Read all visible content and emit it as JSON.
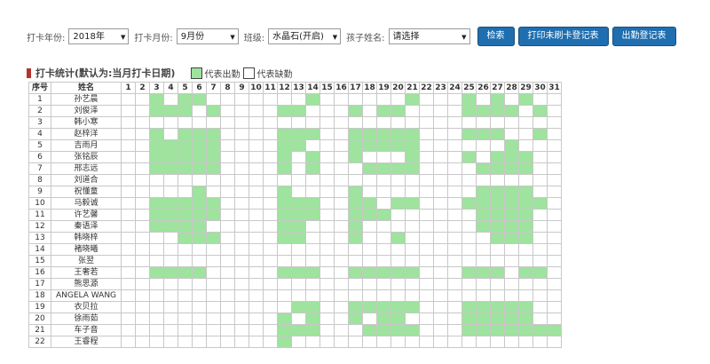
{
  "filters": {
    "year_label": "打卡年份:",
    "year_value": "2018年",
    "month_label": "打卡月份:",
    "month_value": "9月份",
    "class_label": "班级:",
    "class_value": "水晶石(开启)",
    "child_label": "孩子姓名:",
    "child_value": "请选择"
  },
  "buttons": {
    "search": "检索",
    "print_missed": "打印未刷卡登记表",
    "attendance": "出勤登记表"
  },
  "stats": {
    "title": "打卡统计(默认为:当月打卡日期)",
    "legend_present": "代表出勤",
    "legend_absent": "代表缺勤"
  },
  "colors": {
    "present": "#9ee39e",
    "button": "#1f6fb0",
    "title_marker": "#b3342e"
  },
  "table": {
    "col_index": "序号",
    "col_name": "姓名",
    "days": [
      "1",
      "2",
      "3",
      "4",
      "5",
      "6",
      "7",
      "8",
      "9",
      "10",
      "11",
      "12",
      "13",
      "14",
      "15",
      "16",
      "17",
      "18",
      "19",
      "20",
      "21",
      "22",
      "23",
      "24",
      "25",
      "26",
      "27",
      "28",
      "29",
      "30",
      "31"
    ],
    "rows": [
      {
        "index": "1",
        "name": "孙艺晨",
        "present": [
          3,
          5,
          6,
          14,
          21,
          25,
          27,
          29
        ]
      },
      {
        "index": "2",
        "name": "刘俊泽",
        "present": [
          3,
          4,
          5,
          7,
          12,
          13,
          17,
          19,
          20,
          25,
          26,
          27,
          28,
          30
        ]
      },
      {
        "index": "3",
        "name": "韩小寒",
        "present": []
      },
      {
        "index": "4",
        "name": "赵梓洋",
        "present": [
          3,
          5,
          6,
          7,
          12,
          13,
          14,
          17,
          18,
          19,
          20,
          21,
          25,
          26,
          27,
          30
        ]
      },
      {
        "index": "5",
        "name": "吉雨月",
        "present": [
          3,
          4,
          5,
          6,
          7,
          12,
          13,
          17,
          18,
          19,
          20,
          21,
          28
        ]
      },
      {
        "index": "6",
        "name": "张铭辰",
        "present": [
          3,
          4,
          5,
          6,
          7,
          12,
          14,
          17,
          21,
          25,
          27,
          28,
          29
        ]
      },
      {
        "index": "7",
        "name": "邢志远",
        "present": [
          3,
          4,
          5,
          6,
          7,
          12,
          14,
          18,
          19,
          20,
          21,
          26,
          27,
          28,
          29
        ]
      },
      {
        "index": "8",
        "name": "刘道合",
        "present": []
      },
      {
        "index": "9",
        "name": "祝懂童",
        "present": [
          6,
          12,
          17,
          26,
          27,
          28,
          29
        ]
      },
      {
        "index": "10",
        "name": "马毅诚",
        "present": [
          3,
          4,
          5,
          6,
          7,
          12,
          13,
          14,
          17,
          18,
          20,
          21,
          25,
          26,
          27,
          28,
          29,
          30
        ]
      },
      {
        "index": "11",
        "name": "许艺馨",
        "present": [
          3,
          4,
          5,
          6,
          7,
          12,
          13,
          14,
          17,
          18,
          19,
          26,
          27,
          28,
          29
        ]
      },
      {
        "index": "12",
        "name": "秦语泽",
        "present": [
          3,
          4,
          5,
          6,
          12,
          13,
          17,
          26,
          27,
          28,
          29
        ]
      },
      {
        "index": "13",
        "name": "韩晓梓",
        "present": [
          5,
          6,
          7,
          12,
          13,
          17,
          20,
          27,
          28,
          29
        ]
      },
      {
        "index": "14",
        "name": "褚晓曦",
        "present": []
      },
      {
        "index": "15",
        "name": "张翌",
        "present": []
      },
      {
        "index": "16",
        "name": "王奢若",
        "present": [
          3,
          4,
          5,
          6,
          12,
          13,
          14,
          17,
          18,
          19,
          20,
          21,
          25,
          26,
          27,
          29,
          30
        ]
      },
      {
        "index": "17",
        "name": "熊思源",
        "present": []
      },
      {
        "index": "18",
        "name": "ANGELA WANG",
        "present": []
      },
      {
        "index": "19",
        "name": "衣贝拉",
        "present": [
          13,
          14,
          17,
          18,
          19,
          20,
          21,
          25,
          26,
          27,
          28,
          29
        ]
      },
      {
        "index": "20",
        "name": "徐雨茹",
        "present": [
          12,
          14,
          17,
          19,
          20,
          25,
          26,
          27,
          28,
          29
        ]
      },
      {
        "index": "21",
        "name": "车子音",
        "present": [
          12,
          13,
          14,
          18,
          19,
          20,
          21,
          25,
          26,
          27,
          28,
          29,
          30,
          31
        ]
      },
      {
        "index": "22",
        "name": "王睿程",
        "present": [
          12
        ]
      }
    ]
  }
}
